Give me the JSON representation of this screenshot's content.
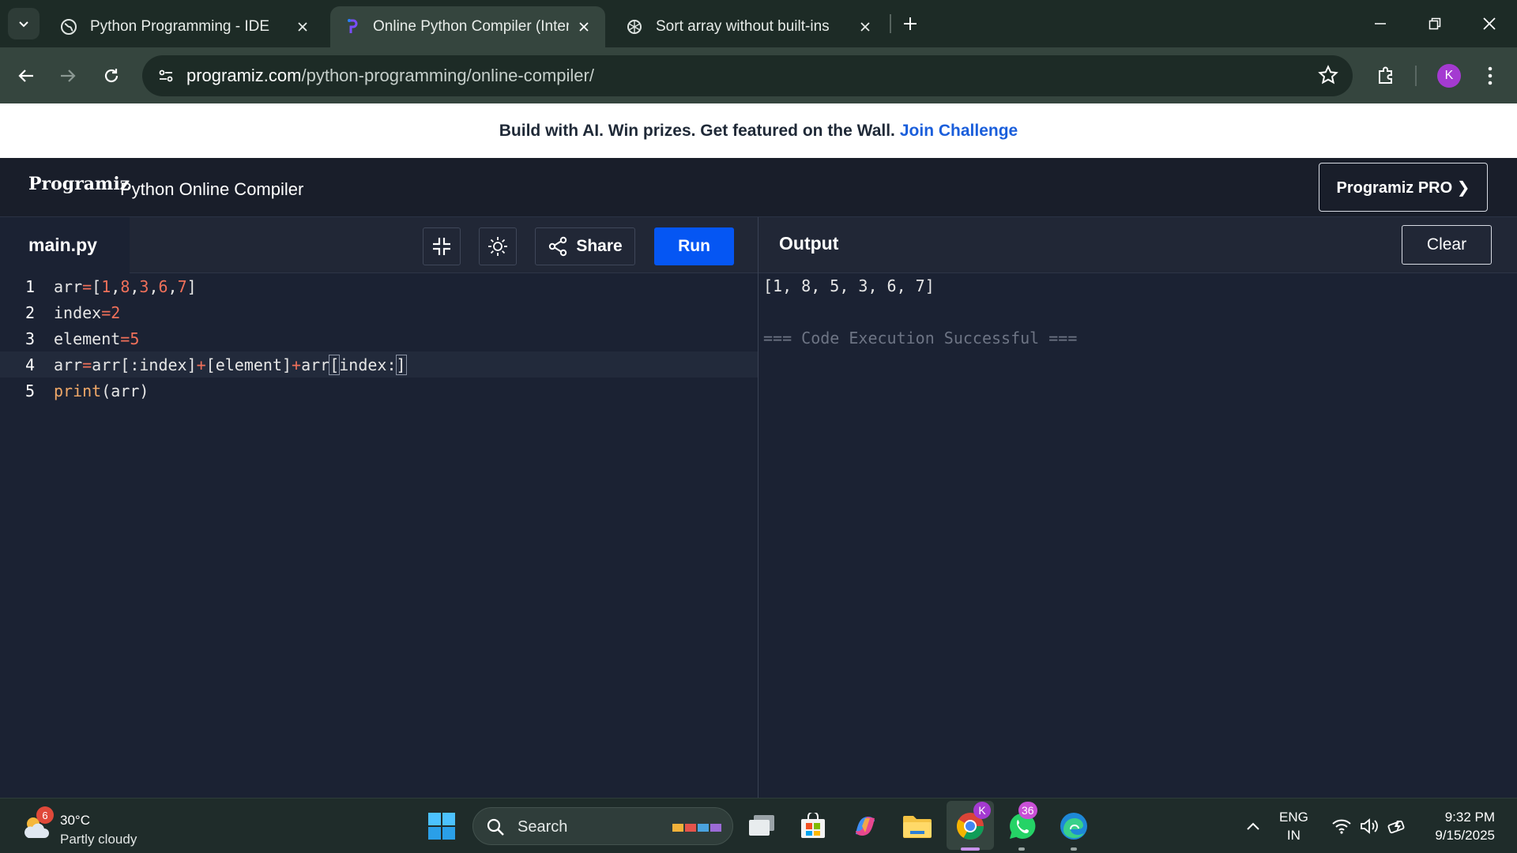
{
  "browser": {
    "tabs": [
      {
        "title": "Python Programming - IDE",
        "active": false
      },
      {
        "title": "Online Python Compiler (Interpreter)",
        "active": true
      },
      {
        "title": "Sort array without built-ins",
        "active": false
      }
    ],
    "url_host": "programiz.com",
    "url_path": "/python-programming/online-compiler/",
    "profile_initial": "K"
  },
  "banner": {
    "text": "Build with AI. Win prizes. Get featured on the Wall.",
    "link": "Join Challenge"
  },
  "site": {
    "logo": "Programiz",
    "title": "Python Online Compiler",
    "pro_button": "Programiz PRO ❯"
  },
  "editor": {
    "file_name": "main.py",
    "share_label": "Share",
    "run_label": "Run",
    "lines": [
      {
        "n": "1"
      },
      {
        "n": "2"
      },
      {
        "n": "3"
      },
      {
        "n": "4"
      },
      {
        "n": "5"
      }
    ]
  },
  "output": {
    "title": "Output",
    "clear_label": "Clear",
    "result": "[1, 8, 5, 3, 6, 7]",
    "status": "=== Code Execution Successful ==="
  },
  "taskbar": {
    "weather_badge": "6",
    "temperature": "30°C",
    "condition": "Partly cloudy",
    "search_label": "Search",
    "chrome_badge": "K",
    "whatsapp_badge": "36",
    "lang_top": "ENG",
    "lang_bottom": "IN",
    "time": "9:32 PM",
    "date": "9/15/2025"
  },
  "colors": {
    "run_button": "#0556f3",
    "editor_bg": "#1b2233",
    "number_token": "#f0705a",
    "function_token": "#f0a868",
    "link": "#1a5edb"
  }
}
